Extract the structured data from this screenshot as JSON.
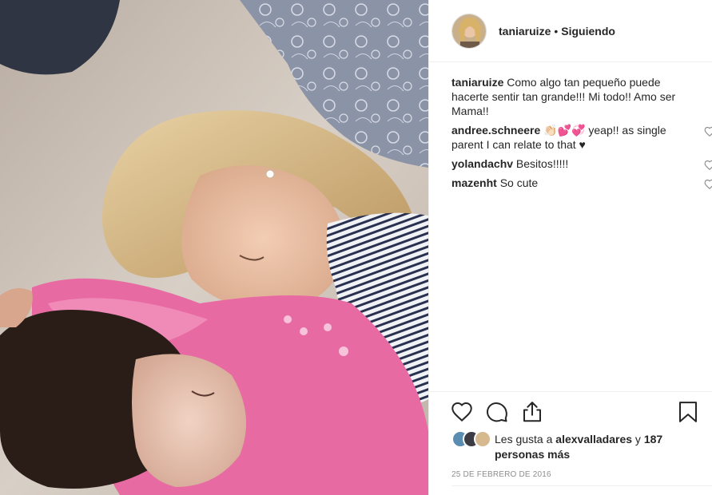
{
  "post": {
    "photo": {
      "description_icon": "photo-mother-and-child-sleeping"
    },
    "header": {
      "username": "taniaruize",
      "separator": "•",
      "follow_state": "Siguiendo"
    },
    "caption": {
      "username": "taniaruize",
      "text": "Como algo tan pequeño puede hacerte sentir tan grande!!! Mi todo!! Amo ser Mama!!"
    },
    "comments": [
      {
        "username": "andree.schneere",
        "emoji": "👏🏻💕💞",
        "text": " yeap!! as single parent I can relate to that ♥"
      },
      {
        "username": "yolandachv",
        "text": "Besitos!!!!!"
      },
      {
        "username": "mazenht",
        "text": "So cute"
      }
    ],
    "actions": {
      "like_icon": "heart-icon",
      "comment_icon": "comment-icon",
      "share_icon": "share-icon",
      "save_icon": "bookmark-icon"
    },
    "likes": {
      "prefix": "Les gusta a ",
      "liker": "alexvalladares",
      "middle": " y ",
      "others": "187 personas más"
    },
    "date": "25 DE FEBRERO DE 2016"
  },
  "colors": {
    "text": "#262626",
    "muted": "#8e8e8e",
    "divider": "#efefef",
    "shirt_pink": "#e86aa3"
  }
}
